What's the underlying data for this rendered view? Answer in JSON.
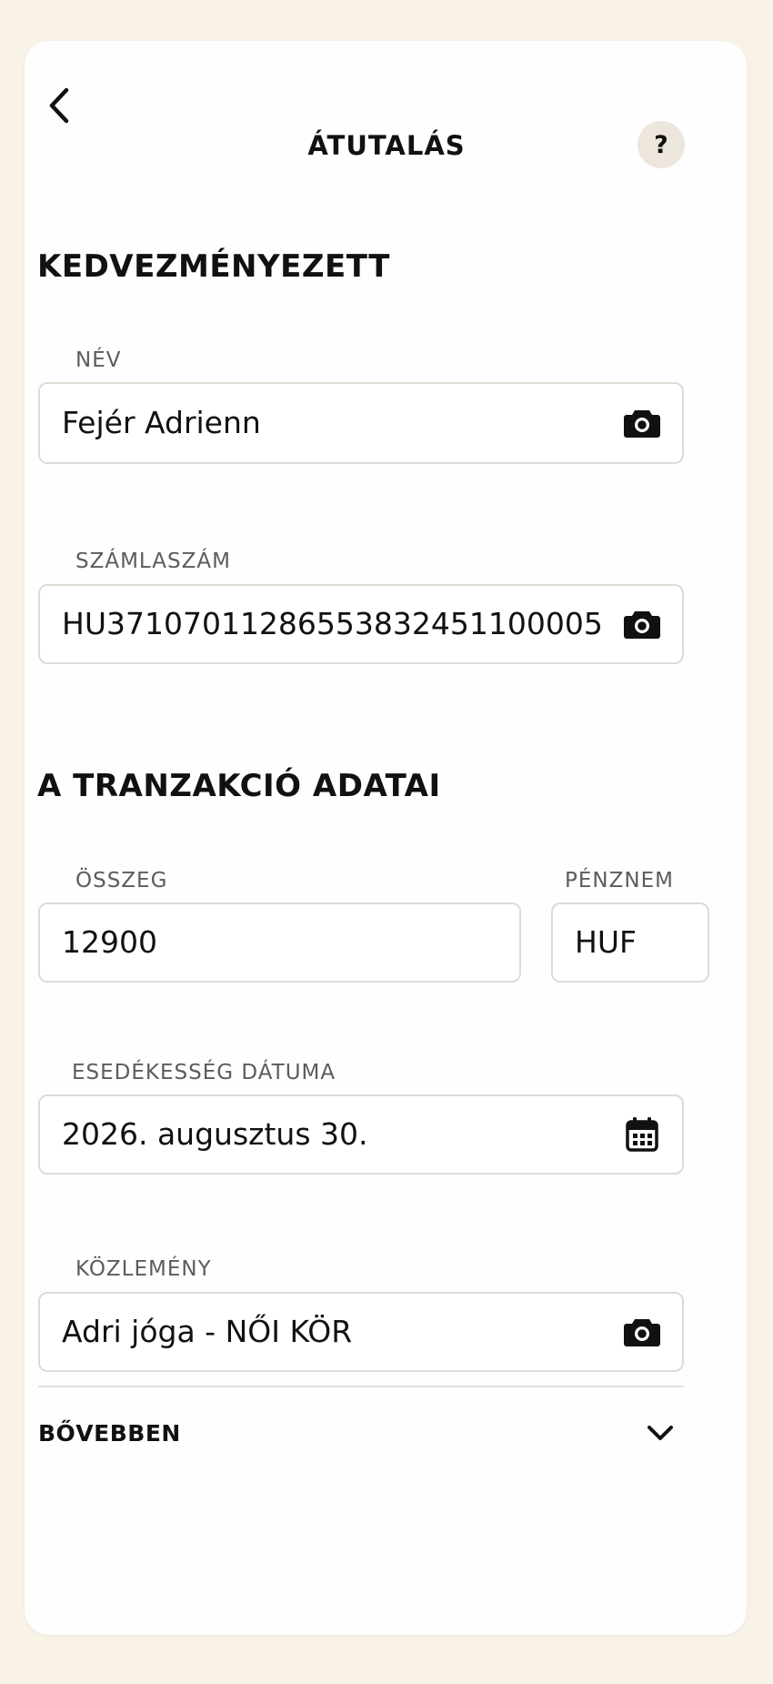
{
  "header": {
    "title": "ÁTUTALÁS",
    "back_icon": "chevron-left-icon",
    "help_label": "?"
  },
  "beneficiary": {
    "section_title": "KEDVEZMÉNYEZETT",
    "name": {
      "label": "NÉV",
      "value": "Fejér Adrienn",
      "icon": "camera-icon"
    },
    "account": {
      "label": "SZÁMLASZÁM",
      "value": "HU37107011286553832451100005",
      "icon": "camera-icon"
    }
  },
  "transaction": {
    "section_title": "A TRANZAKCIÓ ADATAI",
    "amount": {
      "label": "ÖSSZEG",
      "value": "12900"
    },
    "currency": {
      "label": "PÉNZNEM",
      "value": "HUF"
    },
    "due_date": {
      "label": "ESEDÉKESSÉG DÁTUMA",
      "value": "2026. augusztus 30.",
      "icon": "calendar-icon"
    },
    "note": {
      "label": "KÖZLEMÉNY",
      "value": "Adri jóga - NŐI KÖR",
      "icon": "camera-icon"
    }
  },
  "more": {
    "label": "BŐVEBBEN",
    "icon": "chevron-down-icon"
  },
  "colors": {
    "page_background": "#f9f3e7",
    "card_background": "#fefefe",
    "help_button_background": "#ece6dc",
    "field_border": "#dedbd5",
    "label_text": "#5c5c5c",
    "primary_text": "#111111"
  }
}
